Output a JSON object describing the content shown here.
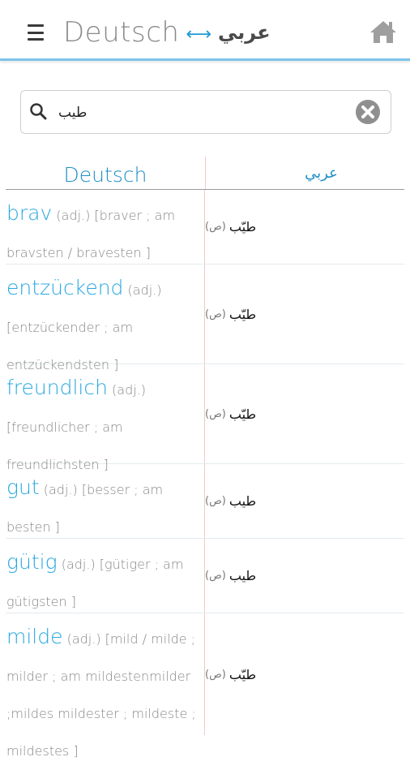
{
  "header": {
    "title_de": "Deutsch",
    "arrow": "⟷",
    "title_ar": "عربي",
    "menu_icon": "hamburger-menu-icon",
    "home_icon": "home-icon"
  },
  "search": {
    "value": "طيب",
    "placeholder": ""
  },
  "table": {
    "col_de": "Deutsch",
    "col_ar": "عربي",
    "rows": [
      {
        "word": "brav",
        "meta": "(adj.) [braver ; am bravsten / bravesten ]",
        "ar": "طيّب",
        "pos": "(ص)"
      },
      {
        "word": "entzückend",
        "meta": "(adj.) [entzückender ; am entzückendsten ]",
        "ar": "طيّب",
        "pos": "(ص)"
      },
      {
        "word": "freundlich",
        "meta": "(adj.) [freundlicher ; am freundlichsten ]",
        "ar": "طيّب",
        "pos": "(ص)"
      },
      {
        "word": "gut",
        "meta": "(adj.) [besser ; am besten ]",
        "ar": "طيب",
        "pos": "(ص)"
      },
      {
        "word": "gütig",
        "meta": "(adj.) [gütiger ; am gütigsten ]",
        "ar": "طيب",
        "pos": "(ص)"
      },
      {
        "word": "milde",
        "meta": "(adj.) [mild / milde ; milder ; am mildestenmilder ;mildes mildester ; mildeste ; mildestes ]",
        "ar": "طيّب",
        "pos": "(ص)"
      }
    ]
  },
  "colors": {
    "accent": "#29a8e0",
    "header_border": "#7cc4ea",
    "divider": "#f4c8c8"
  }
}
